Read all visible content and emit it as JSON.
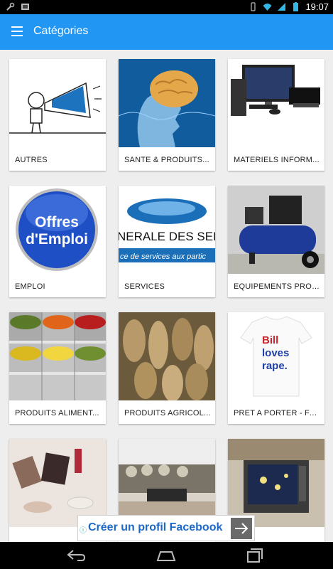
{
  "status_bar": {
    "time": "19:07"
  },
  "app_bar": {
    "title": "Catégories"
  },
  "categories": [
    {
      "label": "AUTRES"
    },
    {
      "label": "SANTE & PRODUITS..."
    },
    {
      "label": "MATERIELS INFORM..."
    },
    {
      "label": "EMPLOI"
    },
    {
      "label": "SERVICES"
    },
    {
      "label": "EQUIPEMENTS PROF..."
    },
    {
      "label": "PRODUITS ALIMENT..."
    },
    {
      "label": "PRODUITS AGRICOL..."
    },
    {
      "label": "PRET A PORTER - FA..."
    },
    {
      "label": ""
    },
    {
      "label": ""
    },
    {
      "label": ""
    }
  ],
  "image_text": {
    "emploi_line1": "Offres",
    "emploi_line2": "d'Emploi",
    "services_line1": "NERALE DES SERVIC",
    "services_line2": "ce de services aux partic",
    "tshirt_line1": "Bill",
    "tshirt_line2": "loves",
    "tshirt_line3": "rape."
  },
  "ad": {
    "text": "Créer un profil Facebook"
  },
  "colors": {
    "app_bar": "#2196f3",
    "background": "#eeeeee",
    "ad_text": "#1d69c9"
  }
}
